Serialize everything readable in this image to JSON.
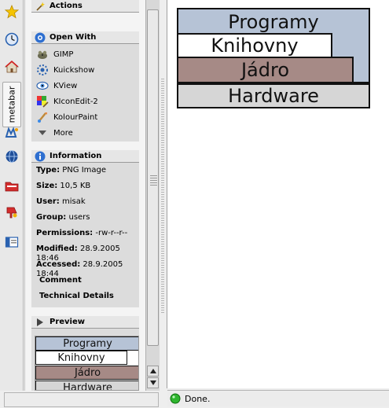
{
  "sidebar": {
    "metabar_tab_label": "metabar"
  },
  "actions": {
    "title": "Actions"
  },
  "open_with": {
    "title": "Open With",
    "apps": [
      {
        "label": "GIMP",
        "icon": "gimp-icon"
      },
      {
        "label": "Kuickshow",
        "icon": "kuickshow-icon"
      },
      {
        "label": "KView",
        "icon": "kview-icon"
      },
      {
        "label": "KIconEdit-2",
        "icon": "kiconedit-icon"
      },
      {
        "label": "KolourPaint",
        "icon": "kolourpaint-icon"
      },
      {
        "label": "More",
        "icon": "more-arrow-icon"
      }
    ]
  },
  "information": {
    "title": "Information",
    "type_label": "Type:",
    "type_value": "PNG Image",
    "size_label": "Size:",
    "size_value": "10,5 KB",
    "user_label": "User:",
    "user_value": "misak",
    "group_label": "Group:",
    "group_value": "users",
    "permissions_label": "Permissions:",
    "permissions_value": "-rw-r--r--",
    "modified_label": "Modified:",
    "modified_value": "28.9.2005 18:46",
    "accessed_label": "Accessed:",
    "accessed_value": "28.9.2005 18:44",
    "comment_label": "Comment",
    "technical_label": "Technical Details"
  },
  "preview": {
    "title": "Preview",
    "layers": [
      "Programy",
      "Knihovny",
      "Jádro",
      "Hardware"
    ]
  },
  "diagram": {
    "layers": [
      {
        "label": "Programy",
        "color": "#b6c3d6"
      },
      {
        "label": "Knihovny",
        "color": "#ffffff"
      },
      {
        "label": "Jádro",
        "color": "#a68a86"
      },
      {
        "label": "Hardware",
        "color": "#d6d6d6"
      }
    ]
  },
  "status": {
    "text": "Done."
  }
}
